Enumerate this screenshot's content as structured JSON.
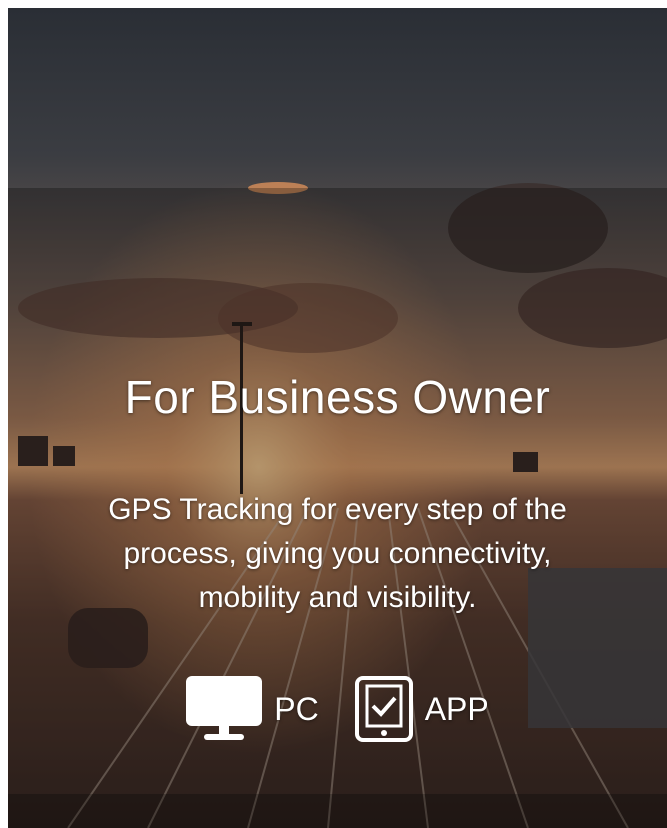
{
  "hero": {
    "title": "For Business Owner",
    "description_lines": [
      "GPS Tracking for every step of the",
      "process, giving you connectivity,",
      "mobility and visibility."
    ]
  },
  "platforms": [
    {
      "label": "PC",
      "icon": "monitor-icon"
    },
    {
      "label": "APP",
      "icon": "tablet-check-icon"
    }
  ],
  "colors": {
    "text": "#ffffff",
    "sky_top": "#2b2f36",
    "horizon": "#c98a5a",
    "ground": "#5a3a2c"
  }
}
